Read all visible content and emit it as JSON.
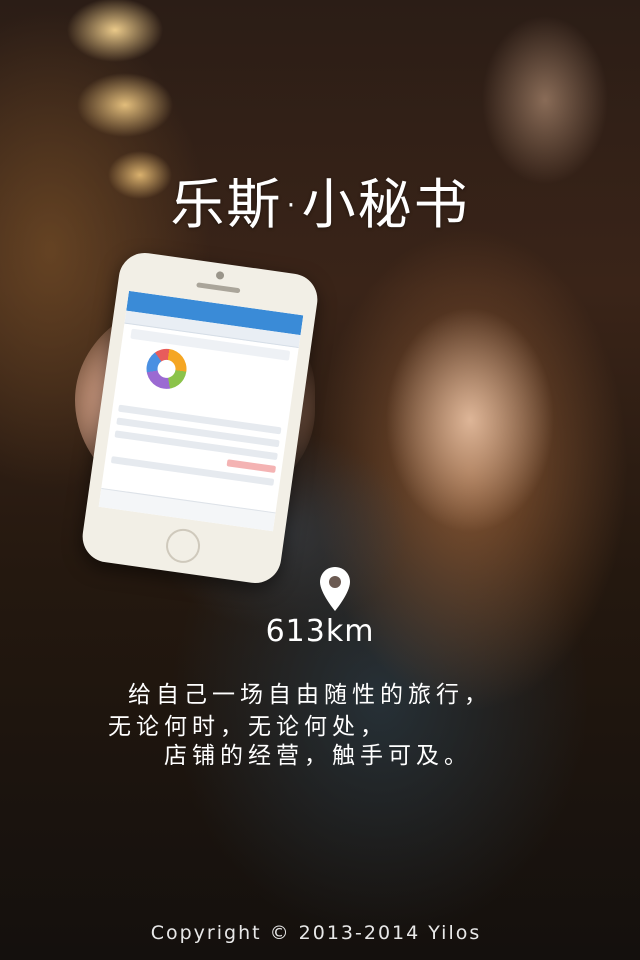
{
  "splash": {
    "title": "乐斯·小秘书",
    "distance": "613km",
    "slogan_lines": [
      "给自己一场自由随性的旅行，",
      "无论何时，无论何处，",
      "店铺的经营，触手可及。"
    ],
    "copyright": "Copyright © 2013-2014 Yilos",
    "location_icon": "location-pin-icon"
  },
  "colors": {
    "text": "#ffffff",
    "phone_accent": "#3a8bd7",
    "nail_polish": "#5a1628"
  }
}
